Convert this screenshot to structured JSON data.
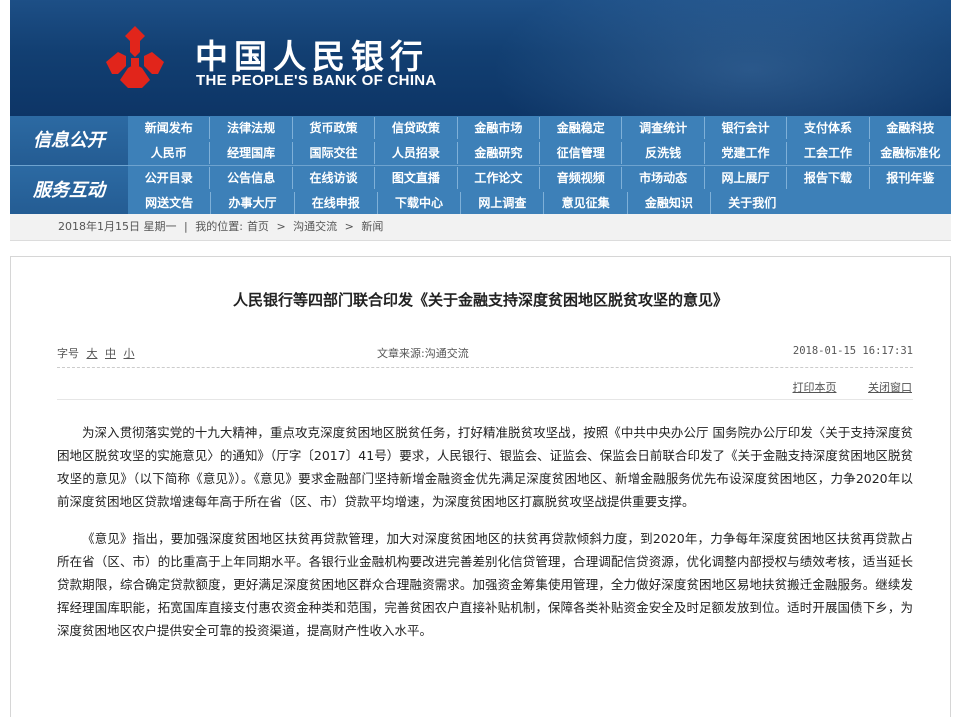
{
  "header": {
    "title_cn": "中国人民银行",
    "title_en": "THE PEOPLE'S BANK OF CHINA",
    "logo_color": "#e1251b",
    "banner_color": "#123f72"
  },
  "nav": {
    "block1_label": "信息公开",
    "block2_label": "服务互动",
    "row1": [
      "新闻发布",
      "法律法规",
      "货币政策",
      "信贷政策",
      "金融市场",
      "金融稳定",
      "调查统计",
      "银行会计",
      "支付体系",
      "金融科技"
    ],
    "row2": [
      "人民币",
      "经理国库",
      "国际交往",
      "人员招录",
      "金融研究",
      "征信管理",
      "反洗钱",
      "党建工作",
      "工会工作",
      "金融标准化"
    ],
    "row3": [
      "公开目录",
      "公告信息",
      "在线访谈",
      "图文直播",
      "工作论文",
      "音频视频",
      "市场动态",
      "网上展厅",
      "报告下载",
      "报刊年鉴"
    ],
    "row4": [
      "网送文告",
      "办事大厅",
      "在线申报",
      "下载中心",
      "网上调查",
      "意见征集",
      "金融知识",
      "关于我们"
    ]
  },
  "breadcrumb": {
    "date": "2018年1月15日 星期一",
    "separator": "|",
    "location_label": "我的位置:",
    "home": "首页",
    "arrow": ">",
    "section": "沟通交流",
    "current": "新闻"
  },
  "article": {
    "title": "人民银行等四部门联合印发《关于金融支持深度贫困地区脱贫攻坚的意见》",
    "font_size_label": "字号",
    "font_sizes": [
      "大",
      "中",
      "小"
    ],
    "source_label": "文章来源:",
    "source": "沟通交流",
    "datetime": "2018-01-15 16:17:31",
    "print_label": "打印本页",
    "close_label": "关闭窗口",
    "paragraphs": [
      "为深入贯彻落实党的十九大精神，重点攻克深度贫困地区脱贫任务，打好精准脱贫攻坚战，按照《中共中央办公厅 国务院办公厅印发〈关于支持深度贫困地区脱贫攻坚的实施意见〉的通知》（厅字〔2017〕41号）要求，人民银行、银监会、证监会、保监会日前联合印发了《关于金融支持深度贫困地区脱贫攻坚的意见》（以下简称《意见》）。《意见》要求金融部门坚持新增金融资金优先满足深度贫困地区、新增金融服务优先布设深度贫困地区，力争2020年以前深度贫困地区贷款增速每年高于所在省（区、市）贷款平均增速，为深度贫困地区打赢脱贫攻坚战提供重要支撑。",
      "《意见》指出，要加强深度贫困地区扶贫再贷款管理，加大对深度贫困地区的扶贫再贷款倾斜力度，到2020年，力争每年深度贫困地区扶贫再贷款占所在省（区、市）的比重高于上年同期水平。各银行业金融机构要改进完善差别化信贷管理，合理调配信贷资源，优化调整内部授权与绩效考核，适当延长贷款期限，综合确定贷款额度，更好满足深度贫困地区群众合理融资需求。加强资金筹集使用管理，全力做好深度贫困地区易地扶贫搬迁金融服务。继续发挥经理国库职能，拓宽国库直接支付惠农资金种类和范围，完善贫困农户直接补贴机制，保障各类补贴资金安全及时足额发放到位。适时开展国债下乡，为深度贫困地区农户提供安全可靠的投资渠道，提高财产性收入水平。"
    ]
  }
}
